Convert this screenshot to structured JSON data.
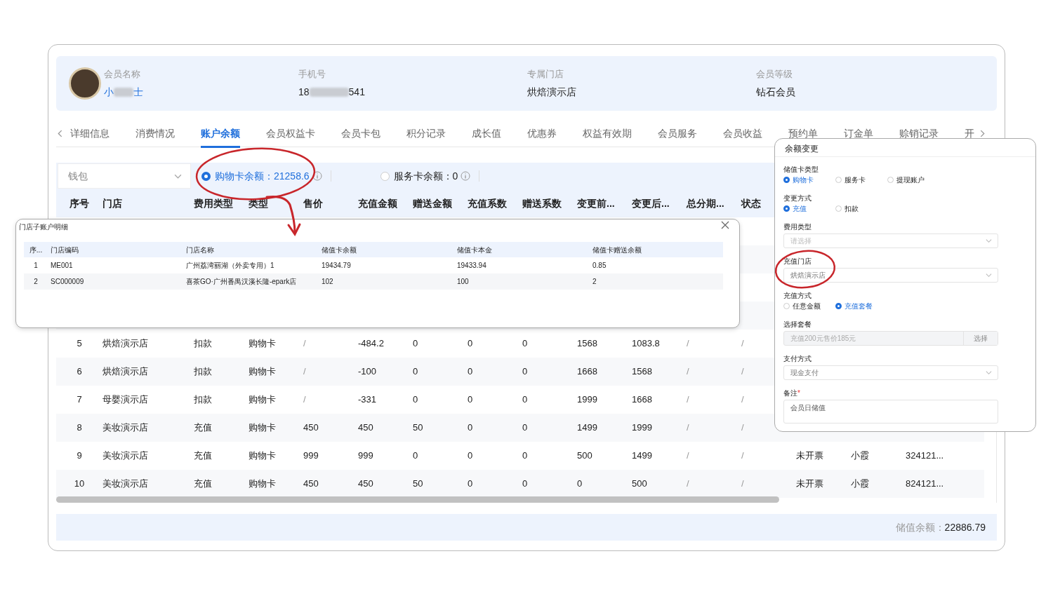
{
  "member": {
    "fields": [
      {
        "label": "会员名称",
        "kind": "masked",
        "before": "小",
        "after": "士",
        "link": true
      },
      {
        "label": "手机号",
        "kind": "masked",
        "before": "18",
        "after": "541",
        "link": false
      },
      {
        "label": "专属门店",
        "kind": "plain",
        "value": "烘焙演示店"
      },
      {
        "label": "会员等级",
        "kind": "plain",
        "value": "钻石会员"
      }
    ]
  },
  "tabs": [
    {
      "label": "详细信息",
      "selected": false
    },
    {
      "label": "消费情况",
      "selected": false
    },
    {
      "label": "账户余额",
      "selected": true
    },
    {
      "label": "会员权益卡",
      "selected": false
    },
    {
      "label": "会员卡包",
      "selected": false
    },
    {
      "label": "积分记录",
      "selected": false
    },
    {
      "label": "成长值",
      "selected": false
    },
    {
      "label": "优惠券",
      "selected": false
    },
    {
      "label": "权益有效期",
      "selected": false
    },
    {
      "label": "会员服务",
      "selected": false
    },
    {
      "label": "会员收益",
      "selected": false
    },
    {
      "label": "预约单",
      "selected": false
    },
    {
      "label": "订金单",
      "selected": false
    },
    {
      "label": "赊销记录",
      "selected": false
    },
    {
      "label": "开",
      "selected": false
    }
  ],
  "filter": {
    "wallet": {
      "value": "钱包"
    },
    "balances": [
      {
        "label": "购物卡余额：21258.6",
        "selected": true
      },
      {
        "label": "服务卡余额：0",
        "selected": false
      }
    ]
  },
  "table": {
    "columns": [
      "序号",
      "门店",
      "费用类型",
      "类型",
      "售价",
      "充值金额",
      "赠送金额",
      "充值系数",
      "赠送系数",
      "变更前...",
      "变更后...",
      "总分期...",
      "状态"
    ],
    "rows": [
      {
        "cells": [
          "5",
          "烘焙演示店",
          "扣款",
          "购物卡",
          "/",
          "-484.2",
          "0",
          "0",
          "0",
          "1568",
          "1083.8",
          "/",
          "/"
        ]
      },
      {
        "cells": [
          "6",
          "烘焙演示店",
          "扣款",
          "购物卡",
          "/",
          "-100",
          "0",
          "0",
          "0",
          "1668",
          "1568",
          "/",
          "/"
        ]
      },
      {
        "cells": [
          "7",
          "母婴演示店",
          "扣款",
          "购物卡",
          "/",
          "-331",
          "0",
          "0",
          "0",
          "1999",
          "1668",
          "/",
          "/"
        ]
      },
      {
        "cells": [
          "8",
          "美妆演示店",
          "充值",
          "购物卡",
          "450",
          "450",
          "50",
          "0",
          "0",
          "1499",
          "1999",
          "/",
          "/"
        ]
      },
      {
        "cells": [
          "9",
          "美妆演示店",
          "充值",
          "购物卡",
          "999",
          "999",
          "0",
          "0",
          "0",
          "500",
          "1499",
          "/",
          "/",
          "未开票",
          "小霞",
          "324121..."
        ]
      },
      {
        "cells": [
          "10",
          "美妆演示店",
          "充值",
          "购物卡",
          "450",
          "450",
          "50",
          "0",
          "0",
          "0",
          "500",
          "/",
          "/",
          "未开票",
          "小霞",
          "824121..."
        ]
      }
    ]
  },
  "footer": {
    "label": "储值余额：",
    "value": "22886.79"
  },
  "sub_account_dialog": {
    "title": "门店子账户明细",
    "columns": [
      "序...",
      "门店编码",
      "门店名称",
      "储值卡余额",
      "储值卡本金",
      "储值卡赠送余额"
    ],
    "rows": [
      [
        "1",
        "ME001",
        "广州荔湾丽湖（外卖专用）1",
        "19434.79",
        "19433.94",
        "0.85"
      ],
      [
        "2",
        "SC000009",
        "喜茶GO·广州番禺汉溪长隆-epark店",
        "102",
        "100",
        "2"
      ]
    ]
  },
  "balance_change_panel": {
    "title": "余额变更",
    "sections": [
      {
        "label": "储值卡类型",
        "kind": "radio",
        "options": [
          {
            "label": "购物卡",
            "selected": true
          },
          {
            "label": "服务卡",
            "selected": false
          },
          {
            "label": "提现账户",
            "selected": false
          }
        ]
      },
      {
        "label": "变更方式",
        "kind": "radio",
        "options": [
          {
            "label": "充值",
            "selected": true
          },
          {
            "label": "扣款",
            "selected": false
          }
        ]
      },
      {
        "label": "费用类型",
        "kind": "select",
        "placeholder": "请选择"
      },
      {
        "label": "充值门店",
        "kind": "select",
        "value": "烘焙演示店"
      },
      {
        "label": "充值方式",
        "kind": "radio",
        "options": [
          {
            "label": "任意金额",
            "selected": false
          },
          {
            "label": "充值套餐",
            "selected": true
          }
        ]
      },
      {
        "label": "选择套餐",
        "kind": "picker",
        "value": "充值200元售价185元",
        "button": "选择",
        "disabled": true
      },
      {
        "label": "支付方式",
        "kind": "select",
        "value": "现金支付"
      },
      {
        "label": "备注",
        "kind": "textarea",
        "value": "会员日储值",
        "required_mark": "*"
      }
    ]
  }
}
